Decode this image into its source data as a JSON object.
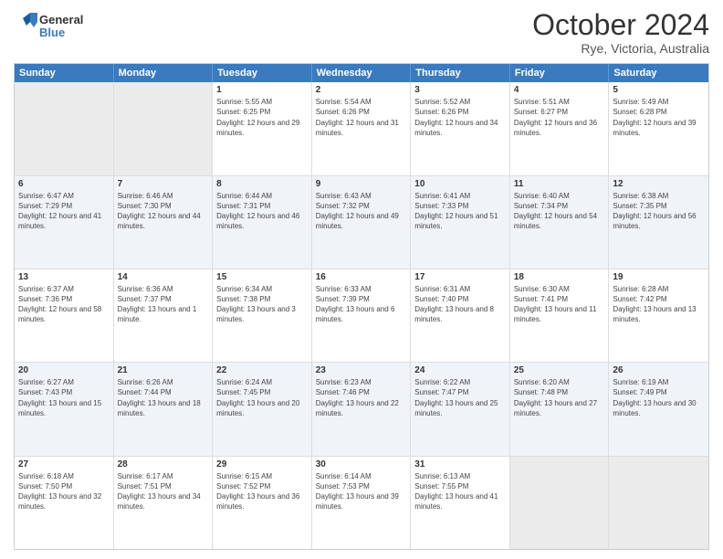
{
  "logo": {
    "line1": "General",
    "line2": "Blue"
  },
  "title": "October 2024",
  "location": "Rye, Victoria, Australia",
  "days_of_week": [
    "Sunday",
    "Monday",
    "Tuesday",
    "Wednesday",
    "Thursday",
    "Friday",
    "Saturday"
  ],
  "weeks": [
    [
      {
        "day": "",
        "sunrise": "",
        "sunset": "",
        "daylight": "",
        "empty": true
      },
      {
        "day": "",
        "sunrise": "",
        "sunset": "",
        "daylight": "",
        "empty": true
      },
      {
        "day": "1",
        "sunrise": "Sunrise: 5:55 AM",
        "sunset": "Sunset: 6:25 PM",
        "daylight": "Daylight: 12 hours and 29 minutes.",
        "empty": false
      },
      {
        "day": "2",
        "sunrise": "Sunrise: 5:54 AM",
        "sunset": "Sunset: 6:26 PM",
        "daylight": "Daylight: 12 hours and 31 minutes.",
        "empty": false
      },
      {
        "day": "3",
        "sunrise": "Sunrise: 5:52 AM",
        "sunset": "Sunset: 6:26 PM",
        "daylight": "Daylight: 12 hours and 34 minutes.",
        "empty": false
      },
      {
        "day": "4",
        "sunrise": "Sunrise: 5:51 AM",
        "sunset": "Sunset: 6:27 PM",
        "daylight": "Daylight: 12 hours and 36 minutes.",
        "empty": false
      },
      {
        "day": "5",
        "sunrise": "Sunrise: 5:49 AM",
        "sunset": "Sunset: 6:28 PM",
        "daylight": "Daylight: 12 hours and 39 minutes.",
        "empty": false
      }
    ],
    [
      {
        "day": "6",
        "sunrise": "Sunrise: 6:47 AM",
        "sunset": "Sunset: 7:29 PM",
        "daylight": "Daylight: 12 hours and 41 minutes.",
        "empty": false
      },
      {
        "day": "7",
        "sunrise": "Sunrise: 6:46 AM",
        "sunset": "Sunset: 7:30 PM",
        "daylight": "Daylight: 12 hours and 44 minutes.",
        "empty": false
      },
      {
        "day": "8",
        "sunrise": "Sunrise: 6:44 AM",
        "sunset": "Sunset: 7:31 PM",
        "daylight": "Daylight: 12 hours and 46 minutes.",
        "empty": false
      },
      {
        "day": "9",
        "sunrise": "Sunrise: 6:43 AM",
        "sunset": "Sunset: 7:32 PM",
        "daylight": "Daylight: 12 hours and 49 minutes.",
        "empty": false
      },
      {
        "day": "10",
        "sunrise": "Sunrise: 6:41 AM",
        "sunset": "Sunset: 7:33 PM",
        "daylight": "Daylight: 12 hours and 51 minutes.",
        "empty": false
      },
      {
        "day": "11",
        "sunrise": "Sunrise: 6:40 AM",
        "sunset": "Sunset: 7:34 PM",
        "daylight": "Daylight: 12 hours and 54 minutes.",
        "empty": false
      },
      {
        "day": "12",
        "sunrise": "Sunrise: 6:38 AM",
        "sunset": "Sunset: 7:35 PM",
        "daylight": "Daylight: 12 hours and 56 minutes.",
        "empty": false
      }
    ],
    [
      {
        "day": "13",
        "sunrise": "Sunrise: 6:37 AM",
        "sunset": "Sunset: 7:36 PM",
        "daylight": "Daylight: 12 hours and 58 minutes.",
        "empty": false
      },
      {
        "day": "14",
        "sunrise": "Sunrise: 6:36 AM",
        "sunset": "Sunset: 7:37 PM",
        "daylight": "Daylight: 13 hours and 1 minute.",
        "empty": false
      },
      {
        "day": "15",
        "sunrise": "Sunrise: 6:34 AM",
        "sunset": "Sunset: 7:38 PM",
        "daylight": "Daylight: 13 hours and 3 minutes.",
        "empty": false
      },
      {
        "day": "16",
        "sunrise": "Sunrise: 6:33 AM",
        "sunset": "Sunset: 7:39 PM",
        "daylight": "Daylight: 13 hours and 6 minutes.",
        "empty": false
      },
      {
        "day": "17",
        "sunrise": "Sunrise: 6:31 AM",
        "sunset": "Sunset: 7:40 PM",
        "daylight": "Daylight: 13 hours and 8 minutes.",
        "empty": false
      },
      {
        "day": "18",
        "sunrise": "Sunrise: 6:30 AM",
        "sunset": "Sunset: 7:41 PM",
        "daylight": "Daylight: 13 hours and 11 minutes.",
        "empty": false
      },
      {
        "day": "19",
        "sunrise": "Sunrise: 6:28 AM",
        "sunset": "Sunset: 7:42 PM",
        "daylight": "Daylight: 13 hours and 13 minutes.",
        "empty": false
      }
    ],
    [
      {
        "day": "20",
        "sunrise": "Sunrise: 6:27 AM",
        "sunset": "Sunset: 7:43 PM",
        "daylight": "Daylight: 13 hours and 15 minutes.",
        "empty": false
      },
      {
        "day": "21",
        "sunrise": "Sunrise: 6:26 AM",
        "sunset": "Sunset: 7:44 PM",
        "daylight": "Daylight: 13 hours and 18 minutes.",
        "empty": false
      },
      {
        "day": "22",
        "sunrise": "Sunrise: 6:24 AM",
        "sunset": "Sunset: 7:45 PM",
        "daylight": "Daylight: 13 hours and 20 minutes.",
        "empty": false
      },
      {
        "day": "23",
        "sunrise": "Sunrise: 6:23 AM",
        "sunset": "Sunset: 7:46 PM",
        "daylight": "Daylight: 13 hours and 22 minutes.",
        "empty": false
      },
      {
        "day": "24",
        "sunrise": "Sunrise: 6:22 AM",
        "sunset": "Sunset: 7:47 PM",
        "daylight": "Daylight: 13 hours and 25 minutes.",
        "empty": false
      },
      {
        "day": "25",
        "sunrise": "Sunrise: 6:20 AM",
        "sunset": "Sunset: 7:48 PM",
        "daylight": "Daylight: 13 hours and 27 minutes.",
        "empty": false
      },
      {
        "day": "26",
        "sunrise": "Sunrise: 6:19 AM",
        "sunset": "Sunset: 7:49 PM",
        "daylight": "Daylight: 13 hours and 30 minutes.",
        "empty": false
      }
    ],
    [
      {
        "day": "27",
        "sunrise": "Sunrise: 6:18 AM",
        "sunset": "Sunset: 7:50 PM",
        "daylight": "Daylight: 13 hours and 32 minutes.",
        "empty": false
      },
      {
        "day": "28",
        "sunrise": "Sunrise: 6:17 AM",
        "sunset": "Sunset: 7:51 PM",
        "daylight": "Daylight: 13 hours and 34 minutes.",
        "empty": false
      },
      {
        "day": "29",
        "sunrise": "Sunrise: 6:15 AM",
        "sunset": "Sunset: 7:52 PM",
        "daylight": "Daylight: 13 hours and 36 minutes.",
        "empty": false
      },
      {
        "day": "30",
        "sunrise": "Sunrise: 6:14 AM",
        "sunset": "Sunset: 7:53 PM",
        "daylight": "Daylight: 13 hours and 39 minutes.",
        "empty": false
      },
      {
        "day": "31",
        "sunrise": "Sunrise: 6:13 AM",
        "sunset": "Sunset: 7:55 PM",
        "daylight": "Daylight: 13 hours and 41 minutes.",
        "empty": false
      },
      {
        "day": "",
        "sunrise": "",
        "sunset": "",
        "daylight": "",
        "empty": true
      },
      {
        "day": "",
        "sunrise": "",
        "sunset": "",
        "daylight": "",
        "empty": true
      }
    ]
  ]
}
